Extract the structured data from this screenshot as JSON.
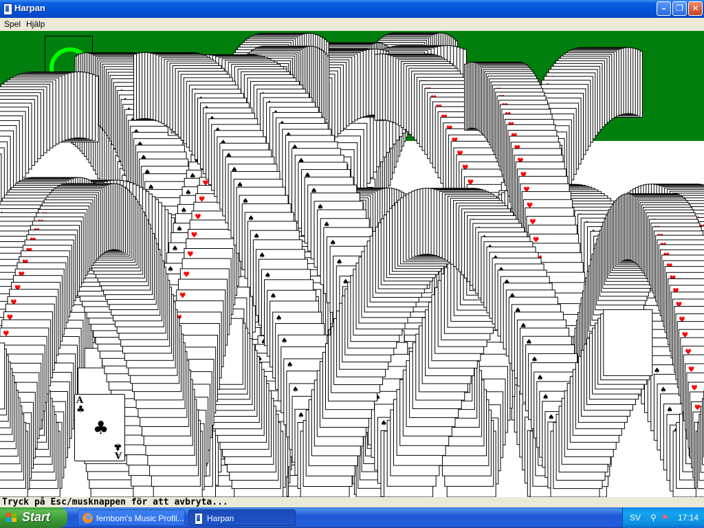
{
  "window": {
    "title": "Harpan"
  },
  "menu": {
    "items": [
      "Spel",
      "Hjälp"
    ]
  },
  "card": {
    "rank": "A",
    "suit": "clubs",
    "suit_symbol": "♣"
  },
  "status": {
    "text": "Tryck på Esc/musknappen för att avbryta..."
  },
  "taskbar": {
    "start_label": "Start",
    "tasks": [
      "fernbom's Music Profil...",
      "Harpan"
    ],
    "language": "SV",
    "clock": "17:14"
  },
  "colors": {
    "felt": "#007f0e",
    "ring": "#00ff00",
    "red_suit": "#ff0000"
  }
}
